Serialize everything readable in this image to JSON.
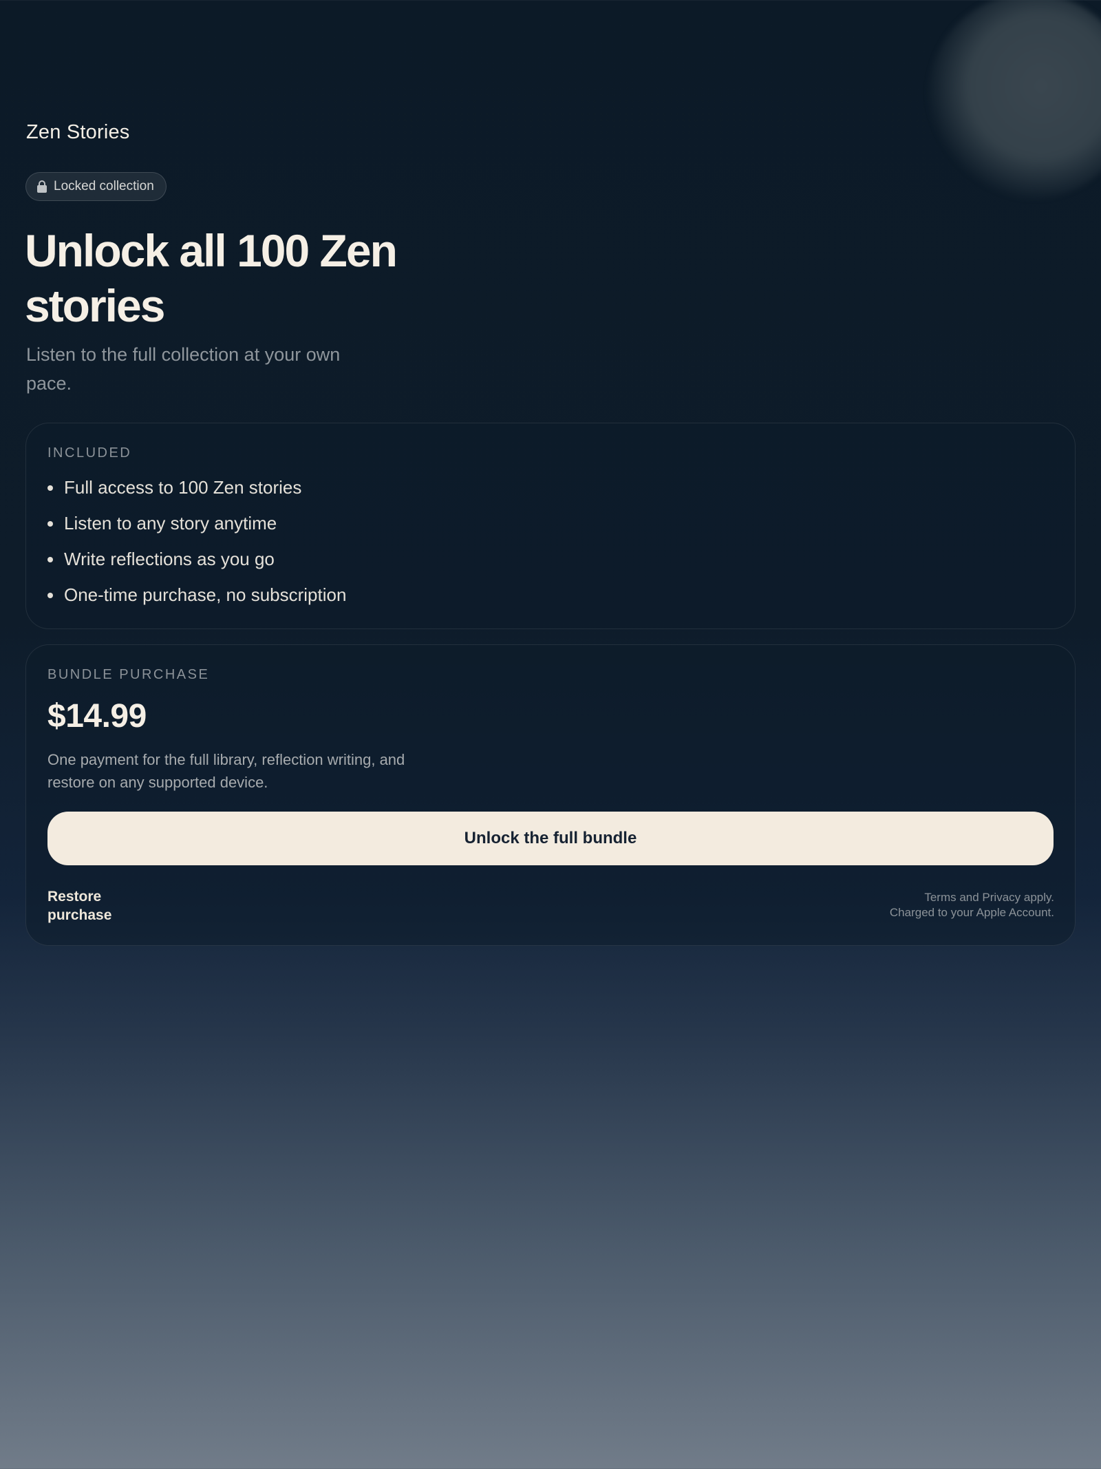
{
  "app": {
    "title": "Zen Stories"
  },
  "badge": {
    "icon": "lock-icon",
    "label": "Locked collection"
  },
  "hero": {
    "headline": "Unlock all 100 Zen stories",
    "subheadline": "Listen to the full collection at your own pace."
  },
  "included": {
    "section_label": "INCLUDED",
    "features": [
      "Full access to 100 Zen stories",
      "Listen to any story anytime",
      "Write reflections as you go",
      "One-time purchase, no subscription"
    ]
  },
  "bundle": {
    "section_label": "BUNDLE PURCHASE",
    "price": "$14.99",
    "description": "One payment for the full library, reflection writing, and restore on any supported device.",
    "cta_label": "Unlock the full bundle",
    "restore_label": "Restore purchase",
    "legal_line_1": "Terms and Privacy apply.",
    "legal_line_2": "Charged to your Apple Account."
  },
  "colors": {
    "background_top": "#0c1a27",
    "background_bottom": "#717c89",
    "cta_background": "#f3ebdf",
    "cta_text": "#162232",
    "primary_text": "#f5efe5",
    "muted_text": "#8b9298"
  }
}
